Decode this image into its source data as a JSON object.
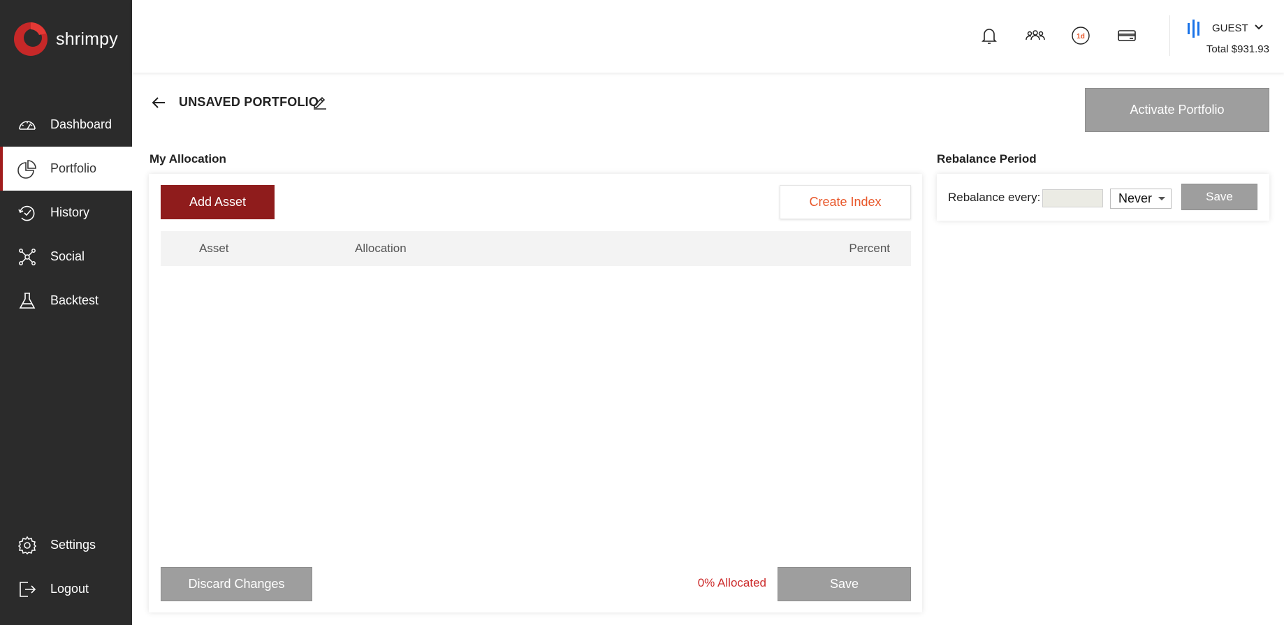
{
  "app": {
    "brand": "shrimpy",
    "brand_color": "#a11d1d"
  },
  "sidebar": {
    "items": [
      {
        "label": "Dashboard",
        "icon": "speedometer-icon"
      },
      {
        "label": "Portfolio",
        "icon": "pie-chart-icon",
        "active": true
      },
      {
        "label": "History",
        "icon": "history-icon"
      },
      {
        "label": "Social",
        "icon": "network-icon"
      },
      {
        "label": "Backtest",
        "icon": "flask-icon"
      }
    ],
    "bottom_items": [
      {
        "label": "Settings",
        "icon": "gear-icon"
      },
      {
        "label": "Logout",
        "icon": "logout-icon"
      }
    ]
  },
  "topbar": {
    "icons": [
      "bell-icon",
      "users-icon",
      "period-1d-icon",
      "card-icon"
    ],
    "period_badge": "1d",
    "user": {
      "name": "GUEST",
      "total": "Total $931.93"
    }
  },
  "page": {
    "title": "UNSAVED PORTFOLIO",
    "activate_label": "Activate Portfolio"
  },
  "allocation": {
    "title": "My Allocation",
    "add_asset_label": "Add Asset",
    "create_index_label": "Create Index",
    "columns": [
      "Asset",
      "Allocation",
      "Percent"
    ],
    "rows": [],
    "discard_label": "Discard Changes",
    "allocated_text": "0% Allocated",
    "save_label": "Save"
  },
  "rebalance": {
    "title": "Rebalance Period",
    "label": "Rebalance every:",
    "input_value": "",
    "selected_option": "Never",
    "save_label": "Save"
  },
  "colors": {
    "sidebar_bg": "#2b2b2b",
    "accent_red": "#8f1c1c",
    "create_index_orange": "#e8572a",
    "allocated_red": "#cc2b2b",
    "disabled_gray": "#9e9e9e",
    "user_blue": "#1a73e8"
  }
}
